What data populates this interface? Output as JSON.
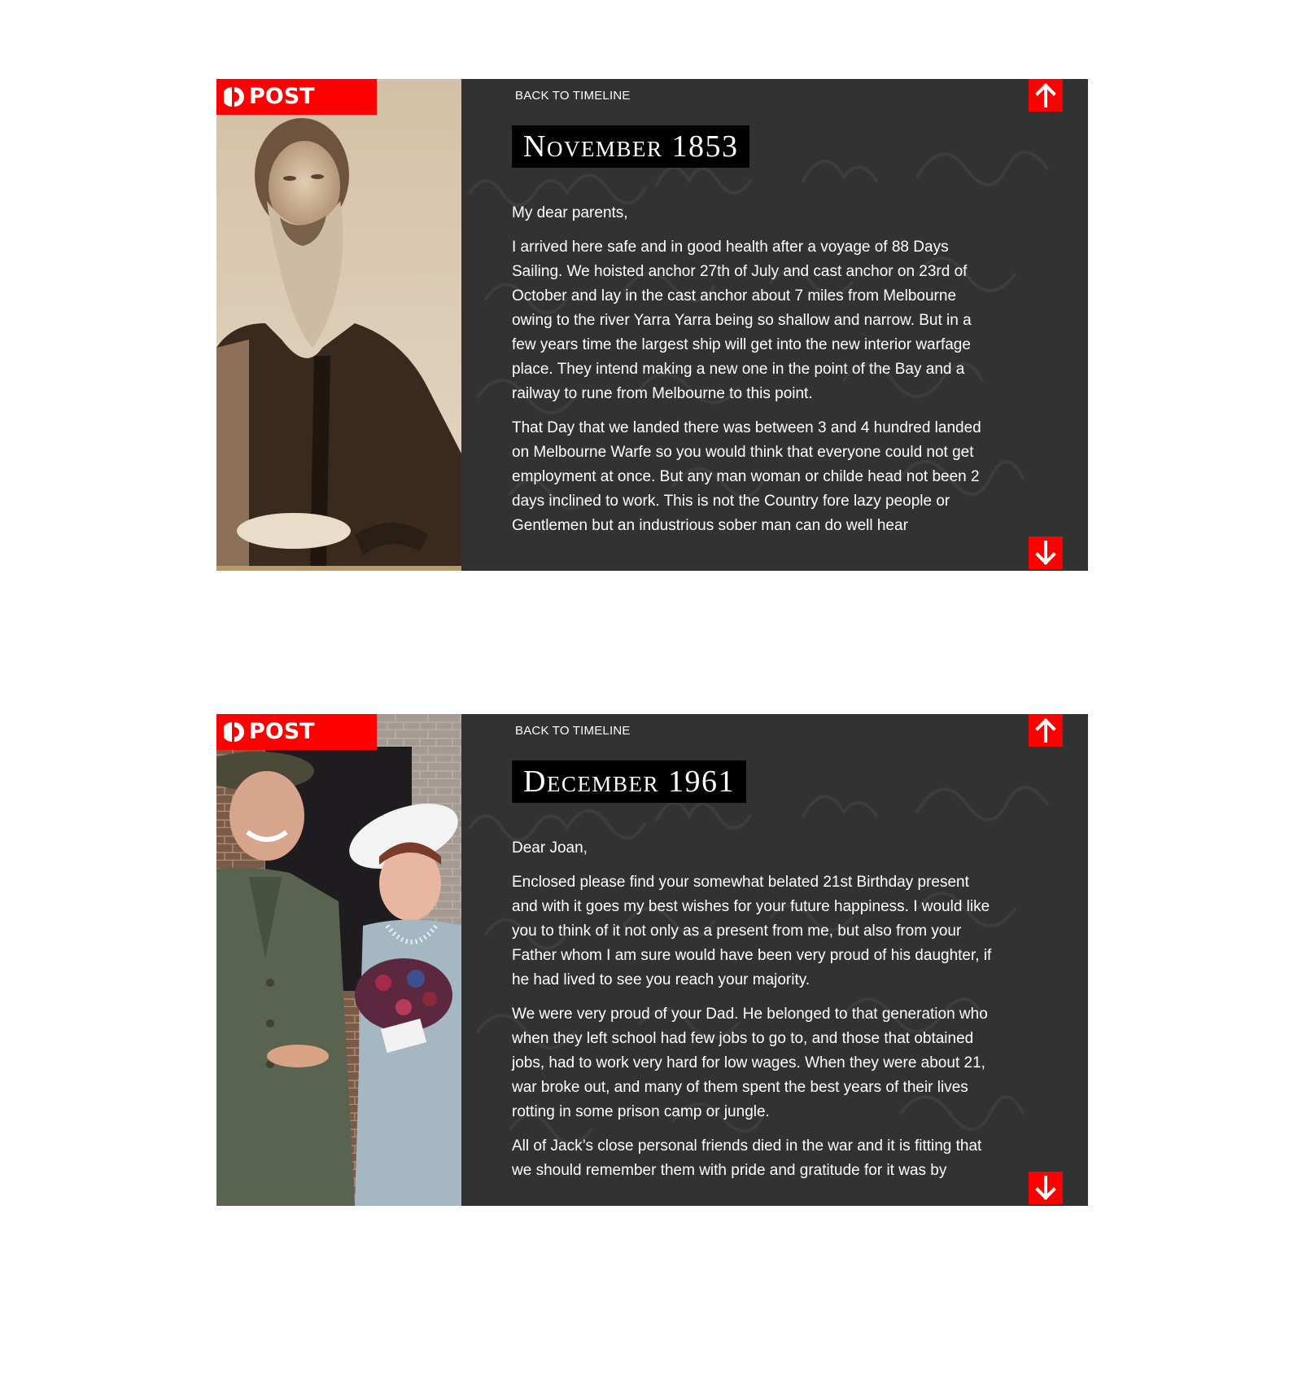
{
  "cards": [
    {
      "logo_text": "POST",
      "back_label": "BACK TO TIMELINE",
      "date": "November 1853",
      "greeting": "My dear parents,",
      "paragraphs": [
        "I arrived here safe and in good health after a voyage of 88 Days Sailing. We hoisted anchor 27th of July and cast anchor on 23rd of October and lay in the cast anchor about 7 miles from Melbourne owing to the river Yarra Yarra being so shallow and narrow. But in a few years time the largest ship will get into the new interior warfage place. They intend making a new one in the point of the Bay and a railway to rune from Melbourne to this point.",
        "That Day that we landed there was between 3 and 4 hundred landed on Melbourne Warfe so you would think that everyone could not get employment at once. But any man woman or childe head not been 2 days inclined to work. This is not the Country fore lazy people or Gentlemen but an industrious sober man can do well hear"
      ],
      "photo": "sepia portrait of bearded man"
    },
    {
      "logo_text": "POST",
      "back_label": "BACK TO TIMELINE",
      "date": "December 1961",
      "greeting": "Dear Joan,",
      "paragraphs": [
        "Enclosed please find your somewhat belated 21st Birthday present and with it goes my best wishes for your future happiness. I would like you to think of it not only as a present from me, but also from your Father whom I am sure would have been very proud of his daughter, if he had lived to see you reach your majority.",
        "We were very proud of your Dad. He belonged to that generation who when they left school had few jobs to go to, and those that obtained jobs, had to work very hard for low wages. When they were about 21, war broke out, and many of them spent the best years of their lives rotting in some prison camp or jungle.",
        "All of Jack’s close personal friends died in the war and it is fitting that we should remember them with pride and gratitude for it was by"
      ],
      "photo": "colour wedding photo of soldier and bride"
    }
  ],
  "colors": {
    "accent": "#ff0000",
    "panel": "#323232",
    "date_bg": "#000000",
    "text": "#ffffff"
  },
  "icons": {
    "logo": "auspost-logo-icon",
    "up": "arrow-up-icon",
    "down": "arrow-down-icon"
  }
}
